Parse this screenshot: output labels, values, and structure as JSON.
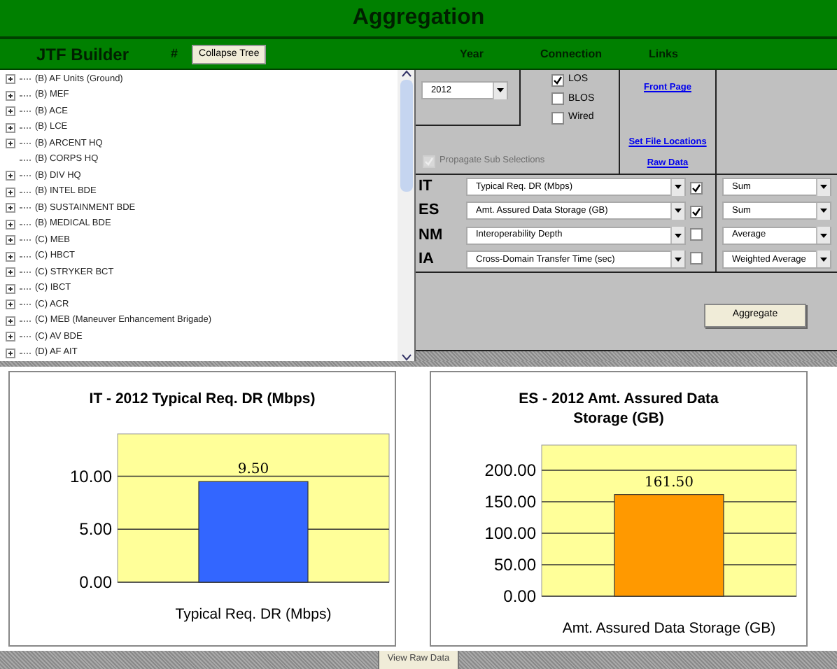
{
  "window": {
    "title": "Aggregation"
  },
  "tree_panel": {
    "title": "JTF Builder",
    "marker": "#",
    "collapse_button": "Collapse Tree",
    "items": [
      {
        "label": "(B) AF Units (Ground)",
        "expandable": true
      },
      {
        "label": "(B) MEF",
        "expandable": true
      },
      {
        "label": "(B) ACE",
        "expandable": true
      },
      {
        "label": "(B) LCE",
        "expandable": true
      },
      {
        "label": "(B) ARCENT HQ",
        "expandable": true
      },
      {
        "label": "(B) CORPS HQ",
        "expandable": false
      },
      {
        "label": "(B) DIV HQ",
        "expandable": true
      },
      {
        "label": "(B) INTEL BDE",
        "expandable": true
      },
      {
        "label": "(B) SUSTAINMENT BDE",
        "expandable": true
      },
      {
        "label": "(B) MEDICAL BDE",
        "expandable": true
      },
      {
        "label": "(C) MEB",
        "expandable": true
      },
      {
        "label": "(C) HBCT",
        "expandable": true
      },
      {
        "label": "(C) STRYKER BCT",
        "expandable": true
      },
      {
        "label": "(C) IBCT",
        "expandable": true
      },
      {
        "label": "(C) ACR",
        "expandable": true
      },
      {
        "label": "(C) MEB (Maneuver Enhancement Brigade)",
        "expandable": true
      },
      {
        "label": "(C) AV BDE",
        "expandable": true
      },
      {
        "label": "(D) AF AIT",
        "expandable": true
      }
    ]
  },
  "headers": {
    "year": "Year",
    "connection": "Connection",
    "links": "Links"
  },
  "year_select": {
    "value": "2012"
  },
  "connections": [
    {
      "label": "LOS",
      "checked": true
    },
    {
      "label": "BLOS",
      "checked": false
    },
    {
      "label": "Wired",
      "checked": false
    }
  ],
  "links": [
    "Front Page",
    "Set File Locations",
    "Raw Data"
  ],
  "propagate": {
    "label": "Propagate Sub Selections",
    "checked": true,
    "disabled": true
  },
  "metrics": [
    {
      "code": "IT",
      "measure": "Typical Req. DR (Mbps)",
      "checked": true,
      "aggregation": "Sum"
    },
    {
      "code": "ES",
      "measure": "Amt. Assured Data Storage (GB)",
      "checked": true,
      "aggregation": "Sum"
    },
    {
      "code": "NM",
      "measure": "Interoperability Depth",
      "checked": false,
      "aggregation": "Average"
    },
    {
      "code": "IA",
      "measure": "Cross-Domain Transfer Time (sec)",
      "checked": false,
      "aggregation": "Weighted Average"
    }
  ],
  "aggregate_button": "Aggregate",
  "charts": [
    {
      "chart_data": {
        "type": "bar",
        "title": "IT - 2012 Typical Req. DR (Mbps)",
        "categories": [
          "Typical Req. DR (Mbps)"
        ],
        "series": [
          {
            "color": "#3366ff",
            "values": [
              9.5
            ]
          }
        ],
        "ylim": [
          0,
          14
        ],
        "yticks": [
          {
            "value": 0,
            "label": "0.00"
          },
          {
            "value": 5,
            "label": "5.00"
          },
          {
            "value": 10,
            "label": "10.00"
          }
        ],
        "grid": true,
        "value_labels": [
          "9.50"
        ]
      }
    },
    {
      "chart_data": {
        "type": "bar",
        "title": "ES - 2012 Amt. Assured Data Storage (GB)",
        "categories": [
          "Amt. Assured Data Storage (GB)"
        ],
        "series": [
          {
            "color": "#ff9900",
            "values": [
              161.5
            ]
          }
        ],
        "ylim": [
          0,
          240
        ],
        "yticks": [
          {
            "value": 0,
            "label": "0.00"
          },
          {
            "value": 50,
            "label": "50.00"
          },
          {
            "value": 100,
            "label": "100.00"
          },
          {
            "value": 150,
            "label": "150.00"
          },
          {
            "value": 200,
            "label": "200.00"
          }
        ],
        "grid": true,
        "value_labels": [
          "161.50"
        ]
      }
    }
  ],
  "sheet_tab": {
    "label": "View Raw Data"
  }
}
